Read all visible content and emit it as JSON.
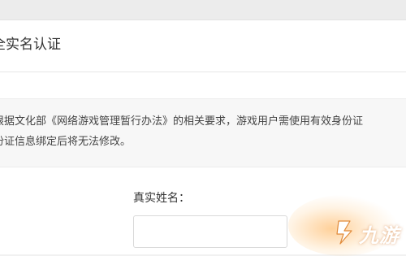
{
  "page": {
    "title": "全实名认证"
  },
  "notice": {
    "line1": "根据文化部《网络游戏管理暂行办法》的相关要求，游戏用户需使用有效身份证",
    "line2": "份证信息绑定后将无法修改。"
  },
  "form": {
    "name_label": "真实姓名：",
    "name_value": ""
  },
  "watermark": {
    "text": "九游",
    "icon": "jiuyou-logo-icon"
  },
  "colors": {
    "background": "#f1f1f1",
    "panel": "#ffffff",
    "notice_bg": "#f7f7f7",
    "text": "#333333",
    "watermark_glow": "#ffaa46"
  }
}
